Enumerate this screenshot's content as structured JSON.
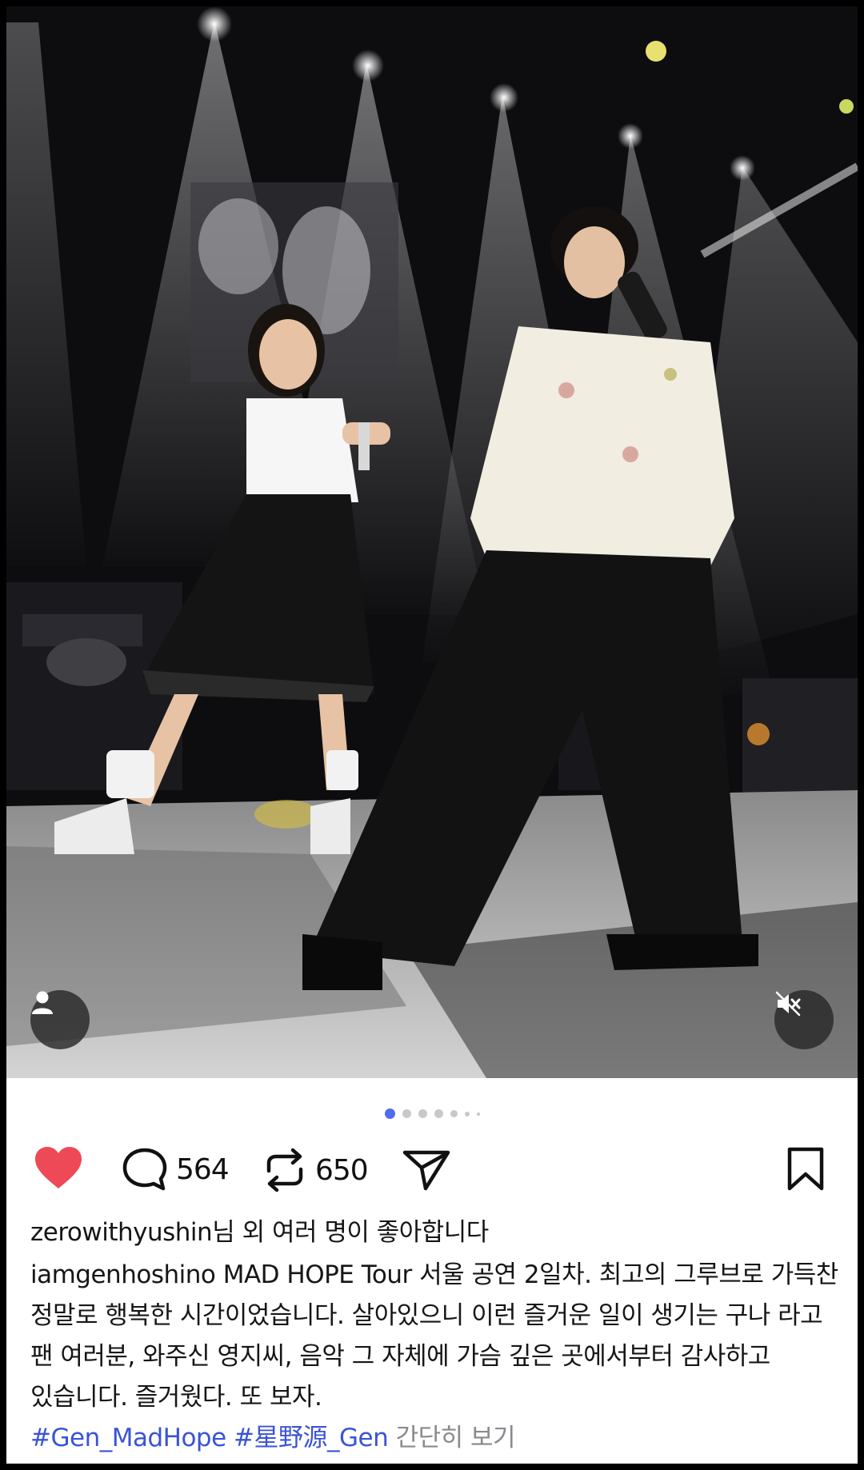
{
  "post": {
    "likes_text": "zerowithyushin님 외 여러 명이 좋아합니다",
    "username": "iamgenhoshino",
    "caption": "MAD HOPE Tour 서울 공연 2일차. 최고의 그루브로 가득찬 정말로 행복한 시간이었습니다. 살아있으니 이런 즐거운 일이 생기는 구나 라고 팬 여러분, 와주신 영지씨, 음악 그 자체에 가슴 깊은 곳에서부터 감사하고 있습니다. 즐거웠다. 또 보자.",
    "hashtags": "#Gen_MadHope #星野源_Gen",
    "more_label": "간단히 보기"
  },
  "actions": {
    "comment_count": "564",
    "repost_count": "650"
  },
  "carousel": {
    "total": 7,
    "active_index": 0
  },
  "icons": {
    "profile": "person-icon",
    "mute": "muted-speaker-icon",
    "like": "heart-filled-icon",
    "comment": "speech-bubble-icon",
    "repost": "repost-arrows-icon",
    "share": "paper-plane-icon",
    "save": "bookmark-icon"
  },
  "colors": {
    "like": "#ed4956",
    "hashtag": "#3a53d6",
    "dot_active": "#4f6cf0"
  }
}
